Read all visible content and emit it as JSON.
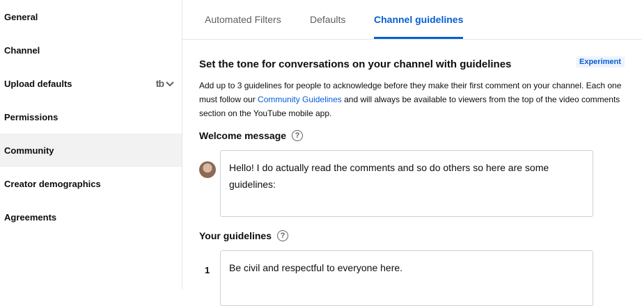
{
  "sidebar": {
    "items": [
      {
        "label": "General"
      },
      {
        "label": "Channel"
      },
      {
        "label": "Upload defaults",
        "trailing_icon": "tb-icon"
      },
      {
        "label": "Permissions"
      },
      {
        "label": "Community",
        "active": true
      },
      {
        "label": "Creator demographics"
      },
      {
        "label": "Agreements"
      }
    ]
  },
  "tabs": [
    {
      "label": "Automated Filters"
    },
    {
      "label": "Defaults"
    },
    {
      "label": "Channel guidelines",
      "active": true
    }
  ],
  "main": {
    "title": "Set the tone for conversations on your channel with guidelines",
    "badge": "Experiment",
    "description_part1": "Add up to 3 guidelines for people to acknowledge before they make their first comment on your channel. Each one must follow our",
    "description_link": "Community Guidelines",
    "description_part2": "and will always be available to viewers from the top of the video comments section on the YouTube mobile app.",
    "welcome_label": "Welcome message",
    "welcome_text": "Hello! I do actually read the comments and so do others so here are some guidelines:",
    "guidelines_label": "Your guidelines",
    "guidelines": [
      {
        "number": "1",
        "text": "Be civil and respectful to everyone here."
      }
    ]
  },
  "colors": {
    "accent": "#065fd4",
    "active_bg": "#f2f2f2",
    "border": "#e5e5e5"
  }
}
